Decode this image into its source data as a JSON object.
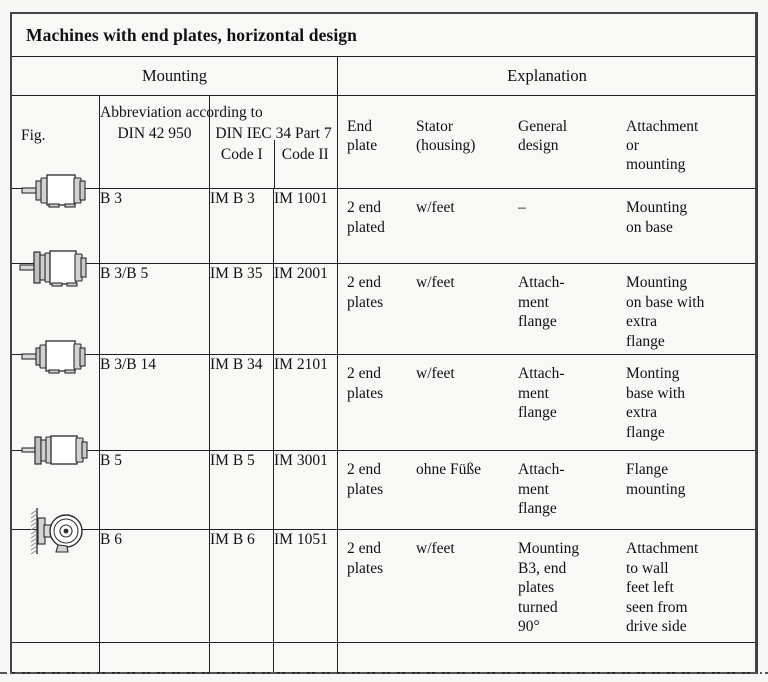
{
  "table": {
    "title": "Machines with end plates, horizontal design",
    "group_headers": {
      "mounting": "Mounting",
      "explanation": "Explanation"
    },
    "column_headers": {
      "fig": "Fig.",
      "abbreviation_title": "Abbreviation according to",
      "din_42_950": "DIN 42 950",
      "din_iec_34_part_7": "DIN IEC 34 Part 7",
      "code_i": "Code I",
      "code_ii": "Code II",
      "end_plate": "End\nplate",
      "end_plate_l1": "End",
      "end_plate_l2": "plate",
      "stator_l1": "Stator",
      "stator_l2": "(housing)",
      "general_l1": "General",
      "general_l2": "design",
      "attachment_l1": "Attachment",
      "attachment_l2": "or",
      "attachment_l3": "mounting"
    },
    "rows": [
      {
        "icon": "motor-feet-side-view",
        "din_42_950": "B 3",
        "code_i": "IM B 3",
        "code_ii": "IM 1001",
        "end_plate": "2 end\nplated",
        "stator": "w/feet",
        "general_design": "–",
        "attachment": "Mounting\non base"
      },
      {
        "icon": "motor-feet-flange-side-view",
        "din_42_950": "B 3/B 5",
        "code_i": "IM B 35",
        "code_ii": "IM 2001",
        "end_plate": "2 end\nplates",
        "stator": "w/feet",
        "general_design": "Attach-\nment\nflange",
        "attachment": "Mounting\non base with\nextra\nflange"
      },
      {
        "icon": "motor-feet-small-flange-side-view",
        "din_42_950": "B 3/B 14",
        "code_i": "IM B 34",
        "code_ii": "IM 2101",
        "end_plate": "2 end\nplates",
        "stator": "w/feet",
        "general_design": "Attach-\nment\nflange",
        "attachment": "Monting\nbase with\nextra\nflange"
      },
      {
        "icon": "motor-flange-no-feet-side-view",
        "din_42_950": "B 5",
        "code_i": "IM B 5",
        "code_ii": "IM 3001",
        "end_plate": "2 end\nplates",
        "stator": "ohne Füße",
        "general_design": "Attach-\nment\nflange",
        "attachment": "Flange\nmounting"
      },
      {
        "icon": "motor-wall-mount-end-view",
        "din_42_950": "B 6",
        "code_i": "IM B 6",
        "code_ii": "IM 1051",
        "end_plate": "2 end\nplates",
        "stator": "w/feet",
        "general_design": "Mounting\nB3, end\nplates\nturned\n90°",
        "attachment": "Attachment\nto wall\nfeet left\nseen from\ndrive side"
      }
    ],
    "colors": {
      "page_background": "#f7f7f6",
      "cell_background": "#f8f8f7",
      "border": "#202020",
      "outer_border": "#444444",
      "text": "#111111",
      "icon_line": "#2b2b2b",
      "icon_fill": "#ffffff",
      "icon_shade": "#c9c9c9"
    }
  }
}
